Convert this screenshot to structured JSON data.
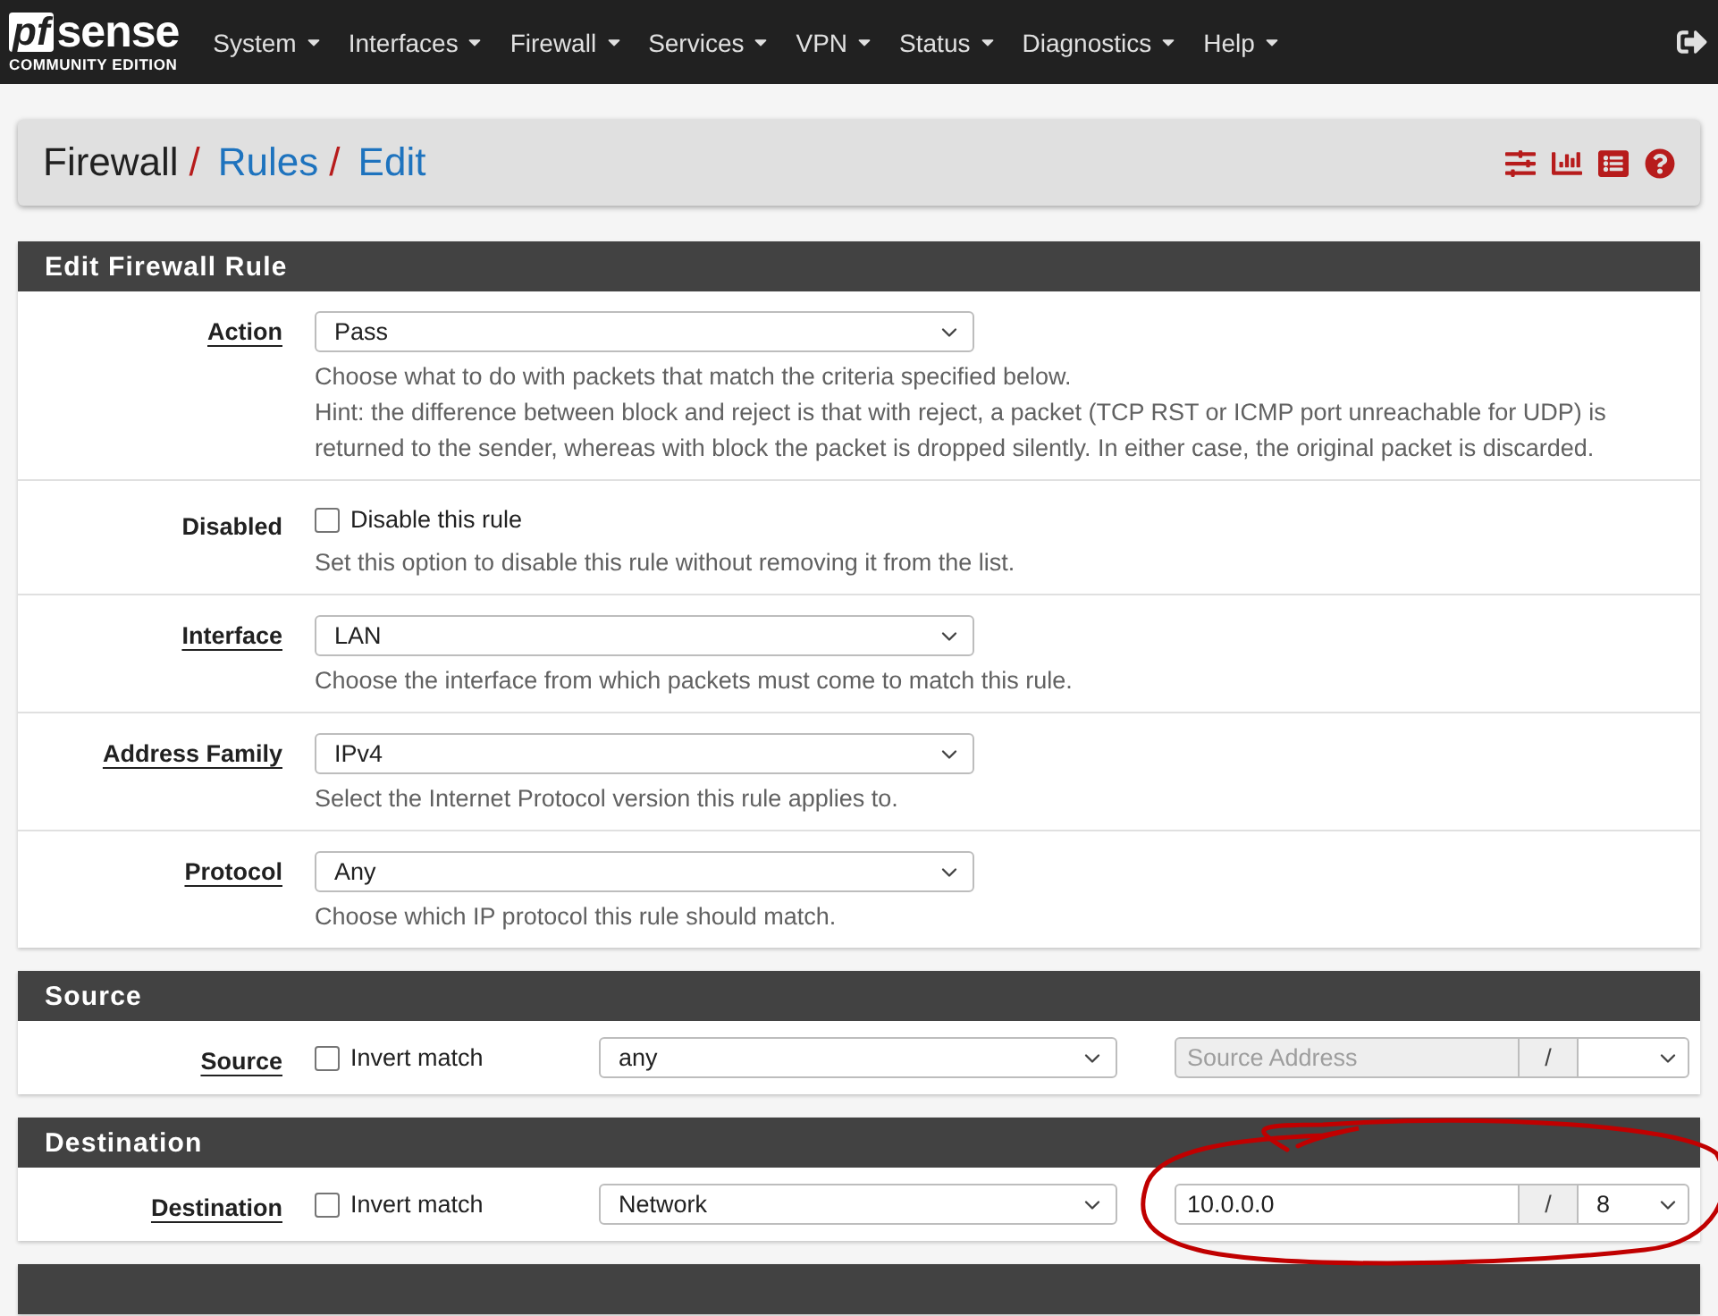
{
  "navbar": {
    "logo": {
      "mark": "pf",
      "name": "sense",
      "edition": "COMMUNITY EDITION"
    },
    "menu": [
      {
        "label": "System"
      },
      {
        "label": "Interfaces"
      },
      {
        "label": "Firewall"
      },
      {
        "label": "Services"
      },
      {
        "label": "VPN"
      },
      {
        "label": "Status"
      },
      {
        "label": "Diagnostics"
      },
      {
        "label": "Help"
      }
    ]
  },
  "breadcrumb": [
    {
      "label": "Firewall",
      "kind": "text",
      "separator": "/"
    },
    {
      "label": "Rules",
      "kind": "link",
      "separator": "/"
    },
    {
      "label": "Edit",
      "kind": "link"
    }
  ],
  "sections": [
    {
      "title": "Edit Firewall Rule",
      "rows": [
        {
          "kind": "select",
          "label": "Action",
          "required": true,
          "value": "Pass",
          "help": [
            "Choose what to do with packets that match the criteria specified below.",
            "Hint: the difference between block and reject is that with reject, a packet (TCP RST or ICMP port unreachable for UDP) is returned to the sender, whereas with block the packet is dropped silently. In either case, the original packet is discarded."
          ]
        },
        {
          "kind": "checkbox",
          "label": "Disabled",
          "required": false,
          "checkbox_label": "Disable this rule",
          "checked": false,
          "help": [
            "Set this option to disable this rule without removing it from the list."
          ]
        },
        {
          "kind": "select",
          "label": "Interface",
          "required": true,
          "value": "LAN",
          "help": [
            "Choose the interface from which packets must come to match this rule."
          ]
        },
        {
          "kind": "select",
          "label": "Address Family",
          "required": true,
          "value": "IPv4",
          "help": [
            "Select the Internet Protocol version this rule applies to."
          ]
        },
        {
          "kind": "select",
          "label": "Protocol",
          "required": true,
          "value": "Any",
          "help": [
            "Choose which IP protocol this rule should match."
          ]
        }
      ]
    },
    {
      "title": "Source",
      "rows": [
        {
          "kind": "address",
          "label": "Source",
          "required": true,
          "invert_label": "Invert match",
          "checked": false,
          "type": "any",
          "address": {
            "placeholder": "Source Address",
            "disabled": true
          },
          "separator": "/"
        }
      ]
    },
    {
      "title": "Destination",
      "rows": [
        {
          "kind": "address",
          "label": "Destination",
          "required": true,
          "invert_label": "Invert match",
          "checked": false,
          "type": "Network",
          "address": {
            "value": "10.0.0.0",
            "disabled": false
          },
          "separator": "/",
          "mask": "8",
          "annotated": true
        }
      ]
    }
  ]
}
